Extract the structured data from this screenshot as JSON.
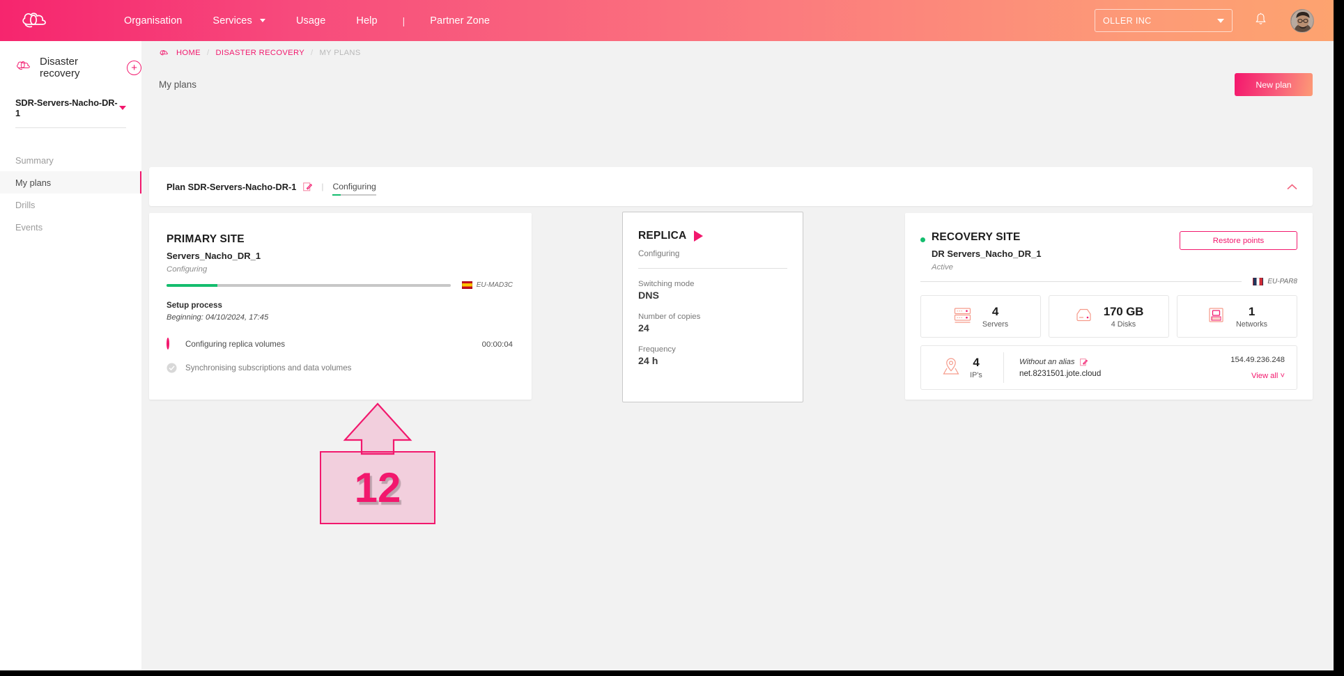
{
  "topnav": {
    "logo_icon": "cloud-logo-icon",
    "links": [
      {
        "label": "Organisation",
        "has_caret": false
      },
      {
        "label": "Services",
        "has_caret": true
      },
      {
        "label": "Usage",
        "has_caret": false
      },
      {
        "label": "Help",
        "has_caret": false
      }
    ],
    "separator": "|",
    "partner_zone": "Partner Zone",
    "org_selector": "OLLER INC",
    "bell_icon": "notification-bell-icon",
    "avatar_icon": "user-avatar"
  },
  "sidebar": {
    "service_icon": "cloud-outline-icon",
    "service_title": "Disaster recovery",
    "add_label": "+",
    "plan_selector": "SDR-Servers-Nacho-DR-1",
    "items": [
      {
        "label": "Summary",
        "active": false
      },
      {
        "label": "My plans",
        "active": true
      },
      {
        "label": "Drills",
        "active": false
      },
      {
        "label": "Events",
        "active": false
      }
    ]
  },
  "breadcrumb": {
    "icon": "cloud-logo-icon",
    "items": [
      "HOME",
      "DISASTER RECOVERY",
      "MY PLANS"
    ],
    "separator": "/"
  },
  "header": {
    "page_title": "My plans",
    "new_plan_label": "New plan"
  },
  "plan_card": {
    "name": "Plan SDR-Servers-Nacho-DR-1",
    "edit_icon": "edit-pencil-icon",
    "separator": "|",
    "status": "Configuring",
    "progress_percent": 18,
    "collapse_icon": "chevron-up-icon"
  },
  "primary_site": {
    "title": "PRIMARY SITE",
    "name": "Servers_Nacho_DR_1",
    "state": "Configuring",
    "progress_percent": 18,
    "region": "EU-MAD3C",
    "flag": "flag-spain-icon",
    "setup_label": "Setup process",
    "beginning": "Beginning: 04/10/2024, 17:45",
    "steps": [
      {
        "icon": "progress-ring-icon",
        "label": "Configuring replica volumes",
        "time": "00:00:04",
        "done": false
      },
      {
        "icon": "check-circle-icon",
        "label": "Synchronising subscriptions and data volumes",
        "time": "",
        "done": true
      }
    ]
  },
  "replica": {
    "title": "REPLICA",
    "play_icon": "play-triangle-icon",
    "state": "Configuring",
    "fields": [
      {
        "label": "Switching mode",
        "value": "DNS"
      },
      {
        "label": "Number of copies",
        "value": "24"
      },
      {
        "label": "Frequency",
        "value": "24 h"
      }
    ]
  },
  "recovery_site": {
    "status_dot": "status-dot-active",
    "title": "RECOVERY SITE",
    "name": "DR Servers_Nacho_DR_1",
    "state": "Active",
    "restore_points_label": "Restore points",
    "region": "EU-PAR8",
    "flag": "flag-france-icon",
    "stats": [
      {
        "icon": "server-rack-icon",
        "value": "4",
        "caption": "Servers"
      },
      {
        "icon": "disk-icon",
        "value": "170 GB",
        "caption": "4 Disks"
      },
      {
        "icon": "network-icon",
        "value": "1",
        "caption": "Networks"
      }
    ],
    "ip_block": {
      "icon": "location-pin-icon",
      "count": "4",
      "count_caption": "IP's",
      "alias": "Without an alias",
      "alias_edit_icon": "edit-pencil-icon",
      "hostname": "net.8231501.jote.cloud",
      "address": "154.49.236.248",
      "view_all_label": "View all"
    }
  },
  "annotation": {
    "number": "12",
    "shape": "up-arrow-callout"
  },
  "colors": {
    "accent_pink": "#f2186d",
    "gradient_start": "#f4176d",
    "gradient_end": "#fd9b76",
    "success_green": "#14bd6e",
    "page_bg": "#f2f2f2"
  }
}
